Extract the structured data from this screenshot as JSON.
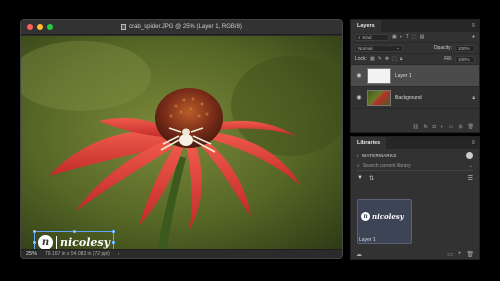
{
  "document": {
    "title": "crab_spider.JPG @ 25% (Layer 1, RGB/8)",
    "status_zoom": "25%",
    "status_info": "79.167 in x 54.083 in (72 ppi)",
    "watermark_text": "nicolesy",
    "watermark_initial": "n"
  },
  "layers_panel": {
    "tab": "Layers",
    "kind_placeholder": "Kind",
    "blend_mode": "Normal",
    "opacity_label": "Opacity:",
    "opacity_value": "100%",
    "lock_label": "Lock:",
    "fill_label": "Fill:",
    "fill_value": "100%",
    "layers": [
      {
        "name": "Layer 1",
        "selected": true
      },
      {
        "name": "Background",
        "selected": false
      }
    ]
  },
  "libraries_panel": {
    "tab": "Libraries",
    "library_name": "WATERMARKS",
    "search_placeholder": "Search current library",
    "asset_label": "Layer 1",
    "asset_text": "nicolesy",
    "asset_initial": "n"
  },
  "colors": {
    "canvas_bg": "#5b6b2b",
    "panel_bg": "#323232",
    "accent": "#3d4456"
  }
}
